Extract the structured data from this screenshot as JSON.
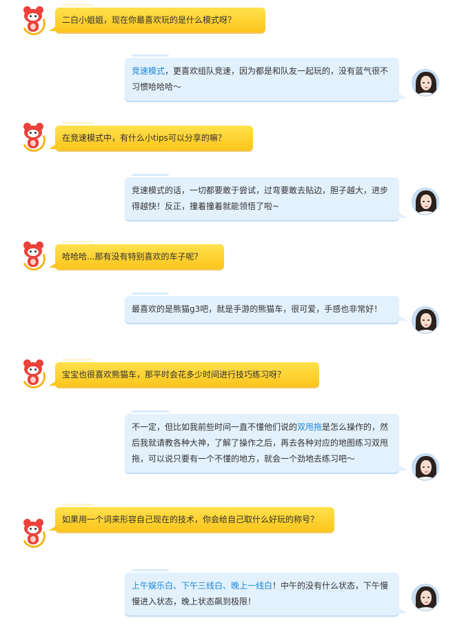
{
  "colors": {
    "question_bubble": "#fcc51c",
    "answer_bubble": "#e3f1fd",
    "highlight": "#1c86d8",
    "mascot_red": "#e8423a"
  },
  "icons": {
    "left_avatar": "red-bear-mascot-avatar",
    "right_avatar": "girl-avatar"
  },
  "conversation": [
    {
      "speaker": "interviewer",
      "text": "二白小姐姐，现在你最喜欢玩的是什么模式呀？"
    },
    {
      "speaker": "player",
      "highlight": "竞速模式",
      "text": "，更喜欢组队竞速，因为都是和队友一起玩的，没有蓝气很不习惯哈哈哈～"
    },
    {
      "speaker": "interviewer",
      "text": "在竞速模式中，有什么小tips可以分享的嘛？"
    },
    {
      "speaker": "player",
      "text": "竞速模式的话，一切都要敢于尝试，过弯要敢去贴边，胆子越大，进步得越快！反正，撞着撞着就能领悟了啦~"
    },
    {
      "speaker": "interviewer",
      "text": "哈哈哈...那有没有特别喜欢的车子呢？"
    },
    {
      "speaker": "player",
      "text": "最喜欢的是熊猫g3吧，就是手游的熊猫车，很可爱，手感也非常好！"
    },
    {
      "speaker": "interviewer",
      "text": "宝宝也很喜欢熊猫车，那平时会花多少时间进行技巧练习呀？"
    },
    {
      "speaker": "player",
      "text_before": "不一定，但比如我前些时间一直不懂他们说的",
      "highlight": "双甩拖",
      "text_after": "是怎么操作的，然后我就请教各种大神，了解了操作之后，再去各种对应的地图练习双甩拖，可以说只要有一个不懂的地方，就会一个劲地去练习吧～"
    },
    {
      "speaker": "interviewer",
      "text": "如果用一个词来形容自己现在的技术，你会给自己取什么好玩的称号？"
    },
    {
      "speaker": "player",
      "highlight": "上午娱乐白、下午三线白、晚上一线白",
      "text": "！中午的没有什么状态，下午慢慢进入状态，晚上状态飙到极限！"
    }
  ]
}
